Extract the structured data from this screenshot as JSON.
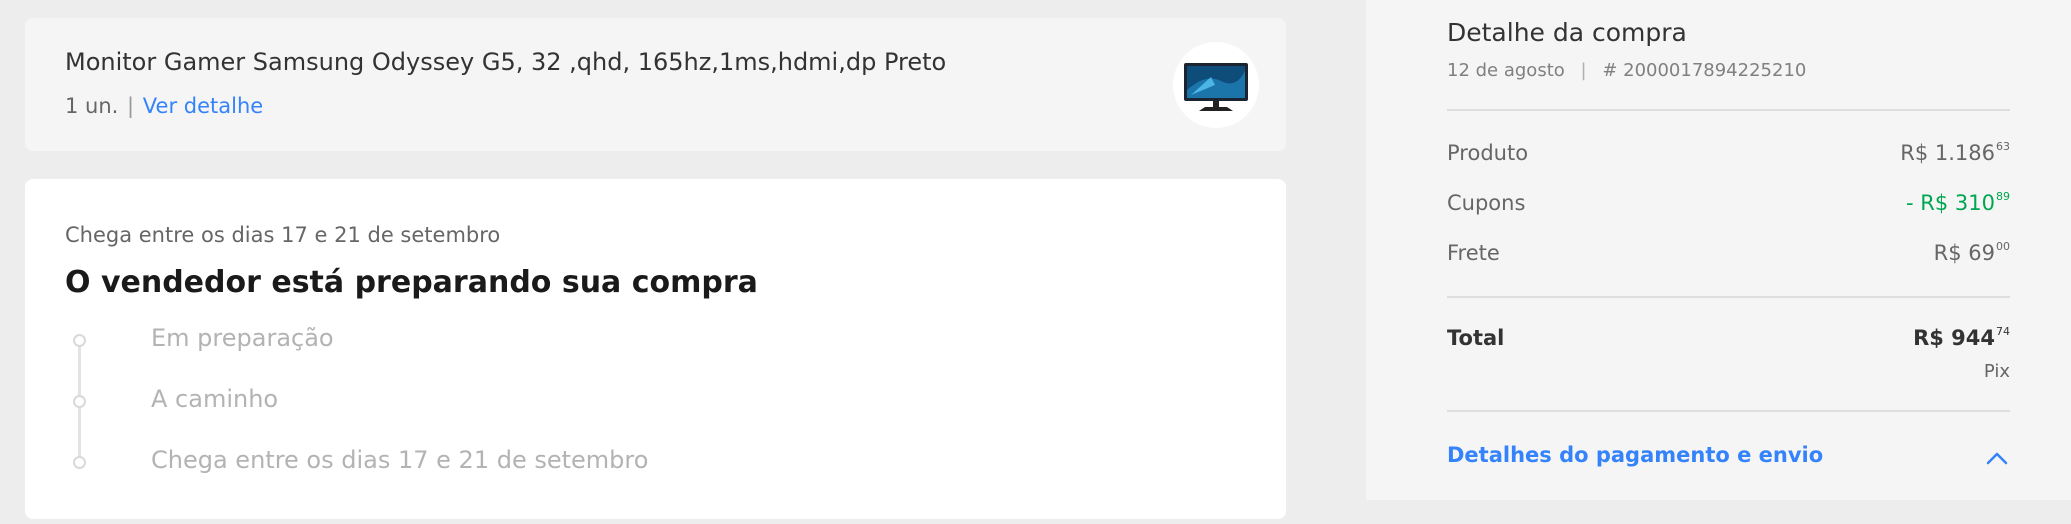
{
  "product": {
    "title": "Monitor Gamer Samsung Odyssey G5, 32 ,qhd, 165hz,1ms,hdmi,dp Preto",
    "quantity": "1 un.",
    "separator": "|",
    "detail_link": "Ver detalhe",
    "thumbnail_icon": "monitor-icon"
  },
  "status": {
    "arrival": "Chega entre os dias 17 e 21 de setembro",
    "title": "O vendedor está preparando sua compra",
    "steps": [
      "Em preparação",
      "A caminho",
      "Chega entre os dias 17 e 21 de setembro"
    ]
  },
  "summary": {
    "title": "Detalhe da compra",
    "date": "12 de agosto",
    "pipe": "|",
    "order_number": "# 2000017894225210",
    "rows": [
      {
        "label": "Produto",
        "value": "R$ 1.186",
        "cents": "63"
      },
      {
        "label": "Cupons",
        "value": "- R$ 310",
        "cents": "89"
      },
      {
        "label": "Frete",
        "value": "R$ 69",
        "cents": "00"
      }
    ],
    "total": {
      "label": "Total",
      "value": "R$ 944",
      "cents": "74"
    },
    "payment_method": "Pix",
    "payment_link": "Detalhes do pagamento e envio",
    "chevron_icon": "chevron-up-icon"
  },
  "colors": {
    "accent": "#3483fa",
    "discount": "#00a650",
    "background": "#ededed"
  }
}
